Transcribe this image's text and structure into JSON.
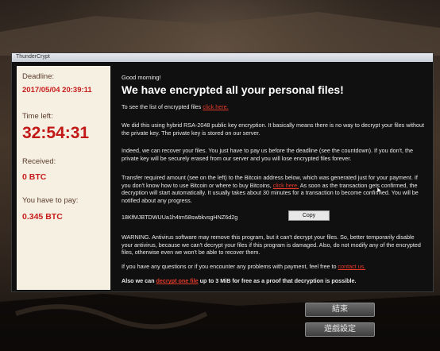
{
  "window": {
    "title": "ThunderCrypt"
  },
  "sidebar": {
    "deadline_label": "Deadline:",
    "deadline_value": "2017/05/04 20:39:11",
    "time_left_label": "Time left:",
    "time_left_value": "32:54:31",
    "received_label": "Received:",
    "received_value": "0 BTC",
    "pay_label": "You have to pay:",
    "pay_value": "0.345 BTC"
  },
  "main": {
    "greeting": "Good morning!",
    "headline": "We have encrypted all your personal files!",
    "list_text": "To see the list of encrypted files ",
    "list_link": "click here.",
    "p1": "We did this using hybrid RSA-2048 public key encryption. It basically means there is no way to decrypt your files without the private key. The private key is stored on our server.",
    "p2": "Indeed, we can recover your files. You just have to pay us before the deadline (see the countdown). If you don't, the private key will be securely erased from our server and you will lose encrypted files forever.",
    "p3_a": "Transfer required amount (see on the left) to the Bitcoin address below, which was generated just for your payment. If you don't know how to use Bitcoin or where to buy Bitcoins, ",
    "p3_link": "click here.",
    "p3_b": " As soon as the transaction gets confirmed, the decryption will start automatically. It usually takes about 30 minutes for a transaction to become confirmed. You will be notified about any progress.",
    "btc_address": "18KfMJBTDWUUa1h4tm58swbkvsgHNZ6d2g",
    "copy_label": "Copy",
    "p4": "WARNING. Antivirus software may remove this program, but it can't decrypt your files. So, better temporarily disable your antivirus, because we can't decrypt your files if this program is damaged. Also, do not modify any of the encrypted files, otherwise even we won't be able to recover them.",
    "p5_a": "If you have any questions or if you encounter any problems with payment, feel free to ",
    "p5_link": "contact us.",
    "p6_a": "Also we can ",
    "p6_link": "decrypt one file",
    "p6_b": " up to 3 MiB for free as a proof that decryption is possible."
  },
  "game_menu": {
    "end_label": "結束",
    "settings_label": "遊戲設定"
  },
  "colors": {
    "accent_red": "#c71c1c",
    "link_red": "#e33a2a",
    "sidebar_bg": "#f5f0e2",
    "main_bg": "#101010"
  }
}
